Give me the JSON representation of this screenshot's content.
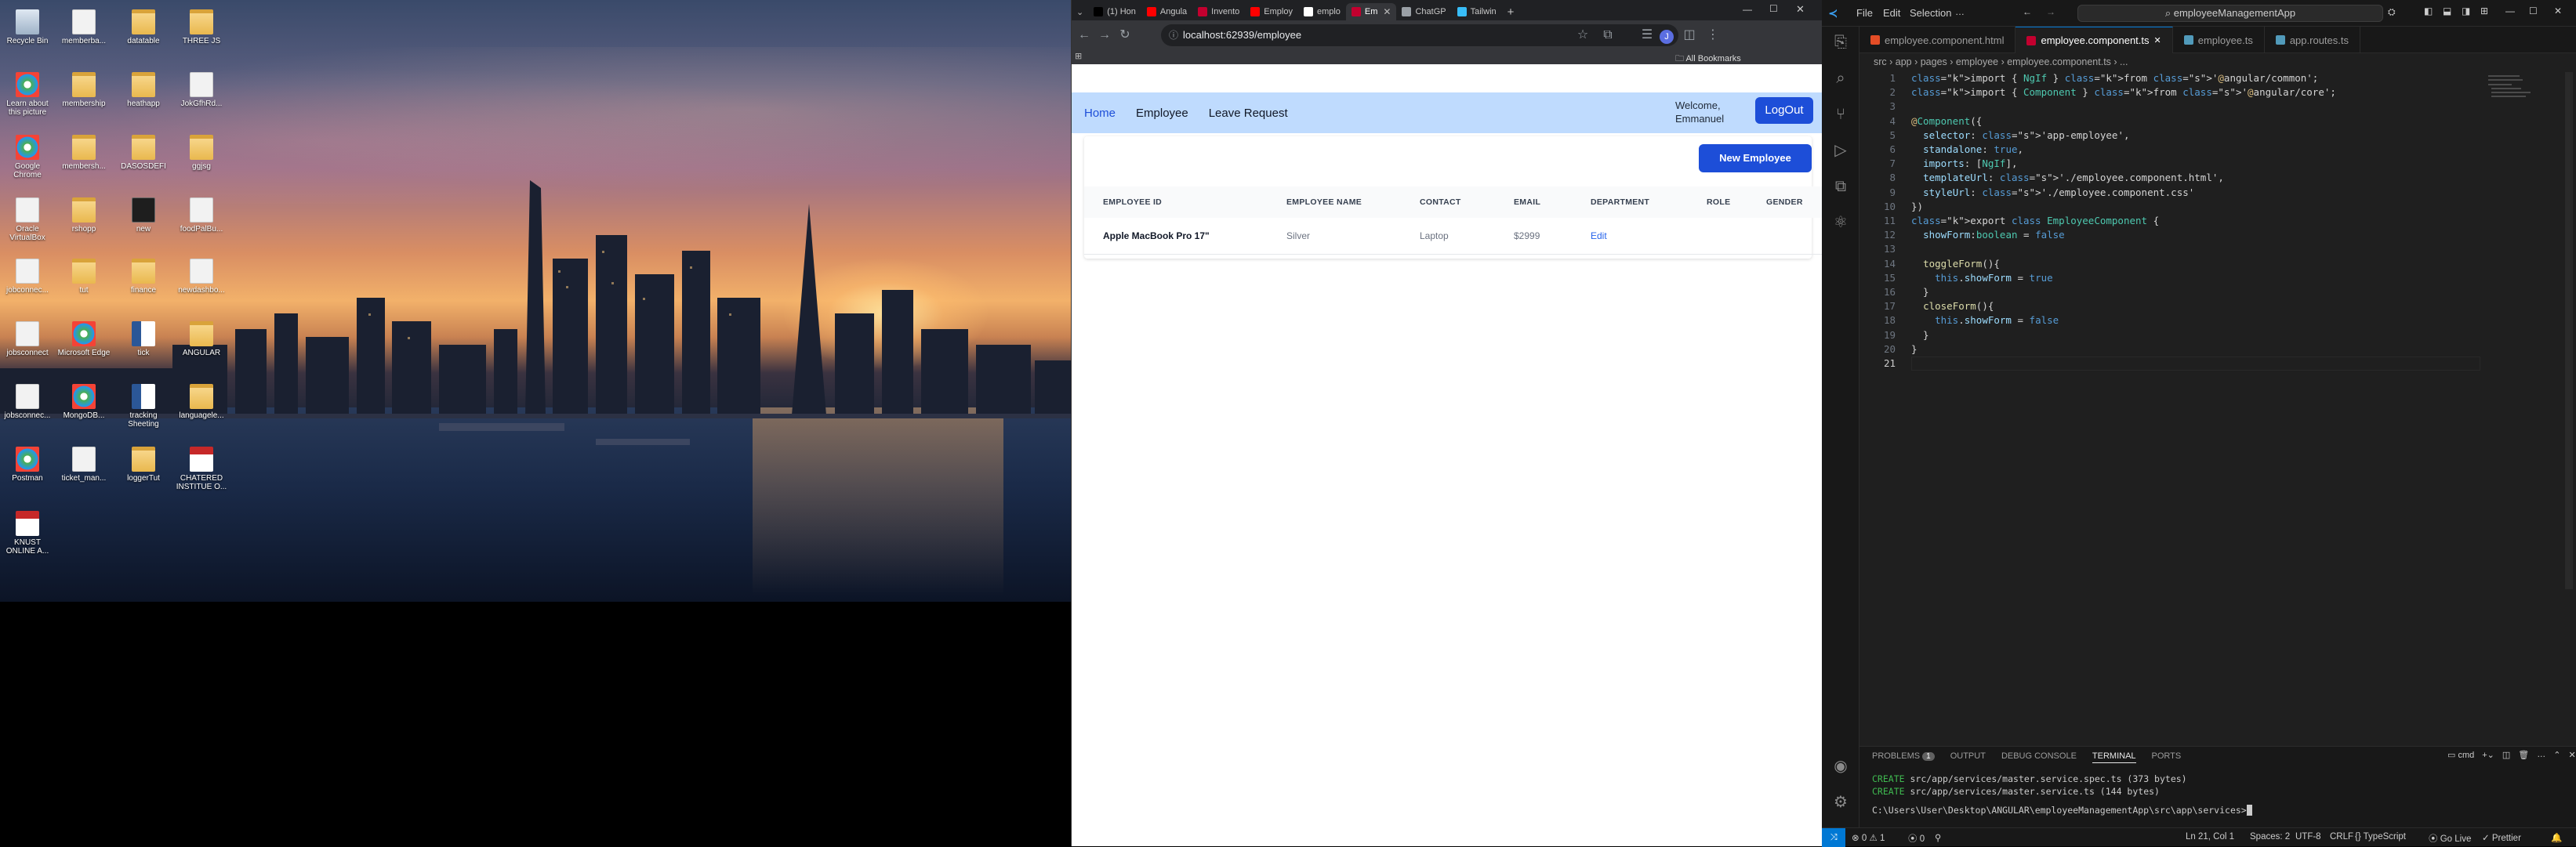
{
  "desktop": {
    "icons": [
      {
        "label": "Recycle Bin",
        "type": "bin"
      },
      {
        "label": "memberba...",
        "type": "file"
      },
      {
        "label": "datatable",
        "type": "folder"
      },
      {
        "label": "THREE JS",
        "type": "folder"
      },
      {
        "label": "Learn about this picture",
        "type": "round"
      },
      {
        "label": "membership",
        "type": "folder"
      },
      {
        "label": "heathapp",
        "type": "folder"
      },
      {
        "label": "JokGfhRd...",
        "type": "file"
      },
      {
        "label": "Google Chrome",
        "type": "round"
      },
      {
        "label": "membersh...",
        "type": "folder"
      },
      {
        "label": "DASOSDEFI",
        "type": "folder"
      },
      {
        "label": "ggjsg",
        "type": "folder"
      },
      {
        "label": "Oracle VirtualBox",
        "type": "file"
      },
      {
        "label": "rshopp",
        "type": "folder"
      },
      {
        "label": "new",
        "type": "exe"
      },
      {
        "label": "foodPalBu...",
        "type": "file"
      },
      {
        "label": "jobconnec...",
        "type": "file"
      },
      {
        "label": "tut",
        "type": "folder"
      },
      {
        "label": "finance",
        "type": "folder"
      },
      {
        "label": "newdashbo...",
        "type": "file"
      },
      {
        "label": "jobsconnect",
        "type": "file"
      },
      {
        "label": "Microsoft Edge",
        "type": "round"
      },
      {
        "label": "tick",
        "type": "word"
      },
      {
        "label": "ANGULAR",
        "type": "folder"
      },
      {
        "label": "jobsconnec...",
        "type": "file"
      },
      {
        "label": "MongoDB...",
        "type": "round"
      },
      {
        "label": "tracking Sheeting",
        "type": "word"
      },
      {
        "label": "languagele...",
        "type": "folder"
      },
      {
        "label": "Postman",
        "type": "round"
      },
      {
        "label": "ticket_man...",
        "type": "file"
      },
      {
        "label": "loggerTut",
        "type": "folder"
      },
      {
        "label": "CHATERED INSTITUE O...",
        "type": "pdf"
      },
      {
        "label": "KNUST ONLINE A...",
        "type": "pdf"
      }
    ]
  },
  "browser": {
    "tabs": [
      {
        "label": "(1) Hon",
        "icon": "x-icon",
        "color": "#000000"
      },
      {
        "label": "Angula",
        "icon": "youtube-icon",
        "color": "#ff0000"
      },
      {
        "label": "Invento",
        "icon": "angular-icon",
        "color": "#c3002f"
      },
      {
        "label": "Employ",
        "icon": "youtube-icon",
        "color": "#ff0000"
      },
      {
        "label": "emplo",
        "icon": "github-icon",
        "color": "#ffffff"
      },
      {
        "label": "Em",
        "icon": "angular-icon",
        "color": "#c3002f",
        "active": true
      },
      {
        "label": "ChatGP",
        "icon": "chatgpt-icon",
        "color": "#9aa0a6"
      },
      {
        "label": "Tailwin",
        "icon": "tailwind-icon",
        "color": "#38bdf8"
      }
    ],
    "url": "localhost:62939/employee",
    "bookmarks_label": "All Bookmarks",
    "app": {
      "nav": [
        "Home",
        "Employee",
        "Leave Request"
      ],
      "welcome_line1": "Welcome,",
      "welcome_line2": "Emmanuel",
      "logout_label": "LogOut",
      "new_employee_label": "New Employee",
      "table": {
        "headers": [
          "EMPLOYEE ID",
          "EMPLOYEE NAME",
          "CONTACT",
          "EMAIL",
          "DEPARTMENT",
          "ROLE",
          "GENDER"
        ],
        "rows": [
          {
            "id": "Apple MacBook Pro 17\"",
            "name": "Silver",
            "contact": "Laptop",
            "email": "$2999",
            "department": "Edit"
          }
        ]
      }
    }
  },
  "vscode": {
    "menu": [
      "File",
      "Edit",
      "Selection"
    ],
    "search": "employeeManagementApp",
    "tabs": [
      {
        "label": "employee.component.html",
        "icon_color": "#e44d26"
      },
      {
        "label": "employee.component.ts",
        "icon_color": "#c3002f",
        "active": true
      },
      {
        "label": "employee.ts",
        "icon_color": "#519aba"
      },
      {
        "label": "app.routes.ts",
        "icon_color": "#519aba"
      }
    ],
    "breadcrumb": "src › app › pages › employee › employee.component.ts › ...",
    "code_lines": [
      "import { NgIf } from '@angular/common';",
      "import { Component } from '@angular/core';",
      "",
      "@Component({",
      "  selector: 'app-employee',",
      "  standalone: true,",
      "  imports: [NgIf],",
      "  templateUrl: './employee.component.html',",
      "  styleUrl: './employee.component.css'",
      "})",
      "export class EmployeeComponent {",
      "  showForm:boolean = false",
      "",
      "  toggleForm(){",
      "    this.showForm = true",
      "  }",
      "  closeForm(){",
      "    this.showForm = false",
      "  }",
      "}",
      ""
    ],
    "panel": {
      "tabs": [
        "PROBLEMS",
        "OUTPUT",
        "DEBUG CONSOLE",
        "TERMINAL",
        "PORTS"
      ],
      "problems_count": "1",
      "shell": "cmd",
      "terminal_lines": [
        {
          "tag": "CREATE",
          "text": "src/app/services/master.service.spec.ts (373 bytes)"
        },
        {
          "tag": "CREATE",
          "text": "src/app/services/master.service.ts (144 bytes)"
        }
      ],
      "prompt": "C:\\Users\\User\\Desktop\\ANGULAR\\employeeManagementApp\\src\\app\\services>"
    },
    "status": {
      "errors": "0",
      "warnings": "1",
      "info": "0",
      "position": "Ln 21, Col 1",
      "spaces": "Spaces: 2",
      "encoding": "UTF-8",
      "eol": "CRLF",
      "language": "TypeScript",
      "golive": "Go Live",
      "prettier": "Prettier"
    }
  }
}
